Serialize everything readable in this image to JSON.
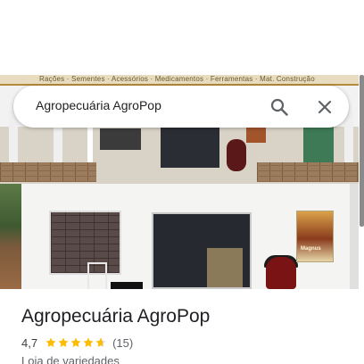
{
  "search": {
    "query": "Agropecuária AgroPop",
    "search_icon": "search-icon",
    "close_icon": "close-icon"
  },
  "photos": {
    "sign_text": "Rações · Sementes · Acessórios · Medicamentos · Ferramentas · Mat. Construção",
    "poster_text": "Magnus"
  },
  "place": {
    "name": "Agropecuária AgroPop",
    "rating": "4,7",
    "rating_fraction": 0.94,
    "review_count": "(15)",
    "category": "Loja de variedades"
  },
  "colors": {
    "star": "#fbbc04",
    "text_primary": "#202124",
    "text_secondary": "#5f6368"
  }
}
